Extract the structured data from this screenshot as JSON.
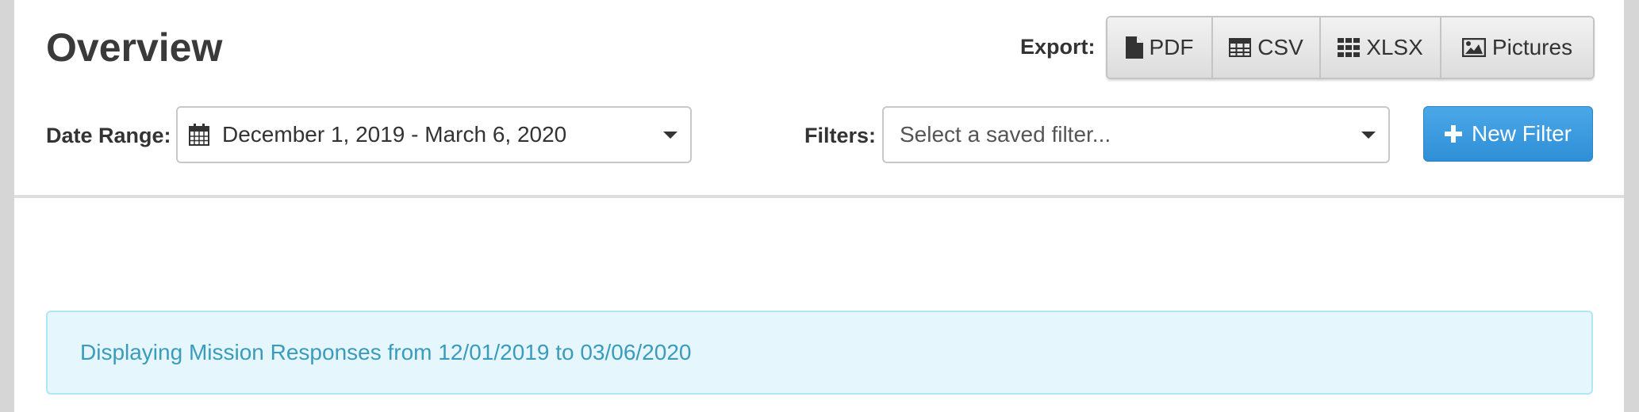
{
  "header": {
    "title": "Overview"
  },
  "export": {
    "label": "Export:",
    "buttons": [
      {
        "label": "PDF",
        "icon": "file-icon"
      },
      {
        "label": "CSV",
        "icon": "table-icon"
      },
      {
        "label": "XLSX",
        "icon": "grid-icon"
      },
      {
        "label": "Pictures",
        "icon": "image-icon"
      }
    ]
  },
  "date_range": {
    "label": "Date Range:",
    "value": "December 1, 2019 - March 6, 2020",
    "icon": "calendar-icon"
  },
  "filters": {
    "label": "Filters:",
    "placeholder": "Select a saved filter...",
    "new_filter_label": "New Filter",
    "new_filter_icon": "plus-icon"
  },
  "info": {
    "message": "Displaying Mission Responses from 12/01/2019 to 03/06/2020"
  },
  "colors": {
    "primary_button": "#3a9be0",
    "info_background": "#e5f7fc",
    "info_border": "#aee8f5",
    "info_text": "#3a9bbd",
    "page_gutter": "#d6d6d6"
  }
}
